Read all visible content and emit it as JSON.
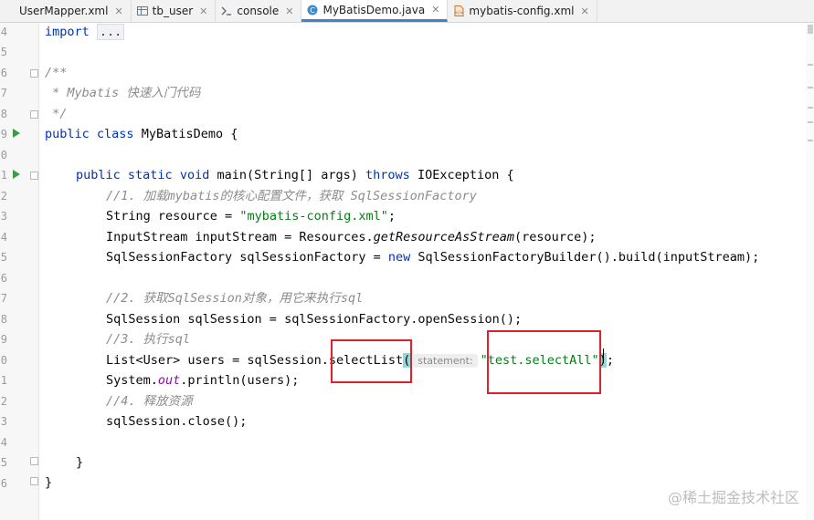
{
  "tabs": [
    {
      "label": "UserMapper.xml",
      "icon": "xml-file-icon",
      "active": false
    },
    {
      "label": "tb_user",
      "icon": "table-icon",
      "active": false
    },
    {
      "label": "console",
      "icon": "console-icon",
      "active": false
    },
    {
      "label": "MyBatisDemo.java",
      "icon": "java-class-icon",
      "active": true
    },
    {
      "label": "mybatis-config.xml",
      "icon": "xml-file-icon",
      "active": false
    }
  ],
  "gutter": {
    "line_numbers": [
      "4",
      "5",
      "6",
      "7",
      "8",
      "9",
      "0",
      "1",
      "2",
      "3",
      "4",
      "5",
      "6",
      "7",
      "8",
      "9",
      "0",
      "1",
      "2",
      "3",
      "4",
      "5",
      "6"
    ]
  },
  "code": {
    "import_kw": "import",
    "import_fold": "...",
    "doc_open": "/**",
    "doc_line": " * Mybatis 快速入门代码",
    "doc_close": " */",
    "class_public": "public",
    "class_kw": "class",
    "class_rest": " MyBatisDemo {",
    "main_public": "public",
    "main_static": "static",
    "main_void": "void",
    "main_rest1": " main(String[] args) ",
    "main_throws": "throws",
    "main_rest2": " IOException {",
    "c1": "//1. 加载mybatis的核心配置文件，获取 SqlSessionFactory",
    "l_res_a": "String resource = ",
    "l_res_str": "\"mybatis-config.xml\"",
    "l_res_b": ";",
    "l_in_a": "InputStream inputStream = Resources.",
    "l_in_m": "getResourceAsStream",
    "l_in_b": "(resource);",
    "l_sf_a": "SqlSessionFactory sqlSessionFactory = ",
    "l_sf_new": "new",
    "l_sf_b": " SqlSessionFactoryBuilder().build(inputStream);",
    "c2": "//2. 获取SqlSession对象，用它来执行sql",
    "l_ss": "SqlSession sqlSession = sqlSessionFactory.openSession();",
    "c3": "//3. 执行sql",
    "l_list_a": "List<User> users = sqlSession.",
    "l_list_m": "selectList",
    "l_list_p": "(",
    "l_list_hint": "statement:",
    "l_list_str_q": "\"",
    "l_list_str": "test.selectAll",
    "l_list_str_q2": "\"",
    "l_list_close": ")",
    "l_list_end": ";",
    "l_print_a": "System.",
    "l_print_out": "out",
    "l_print_b": ".println(users);",
    "c4": "//4. 释放资源",
    "l_close": "sqlSession.close();",
    "brace_method": "}",
    "brace_class": "}"
  },
  "watermark": "@稀土掘金技术社区",
  "colors": {
    "keyword": "#0033b3",
    "string": "#067d17",
    "comment": "#8c8c8c",
    "annotation_box": "#e0202c",
    "run_icon": "#3b9b47",
    "active_tab_underline": "#4083c9"
  }
}
